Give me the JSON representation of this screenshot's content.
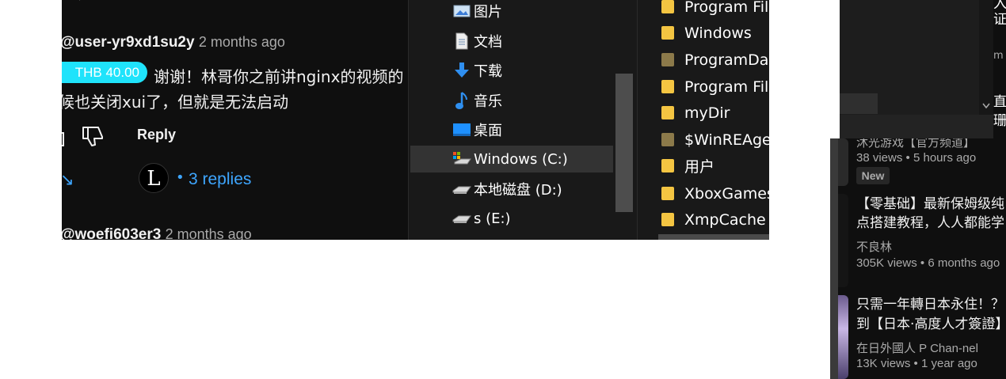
{
  "comments": {
    "first_user": "@user-yr9xd1su2y",
    "first_time": "2 months ago",
    "thanks_amount": "THB 40.00",
    "text_line1": "谢谢！林哥你之前讲nginx的视频的",
    "text_line2": "候也关闭xui了，但就是无法启动",
    "reply_label": "Reply",
    "avatar_letter": "L",
    "separator": "•",
    "replies_label": "3 replies",
    "second_user": "@woefi603er3",
    "second_time": "2 months ago",
    "accent_color": "#3ea6ff",
    "thanks_color": "#1fe3fb"
  },
  "explorer_nav": {
    "items": [
      {
        "label": "图片",
        "icon": "pictures-icon"
      },
      {
        "label": "文档",
        "icon": "documents-icon"
      },
      {
        "label": "下载",
        "icon": "downloads-icon"
      },
      {
        "label": "音乐",
        "icon": "music-icon"
      },
      {
        "label": "桌面",
        "icon": "desktop-icon"
      },
      {
        "label": "Windows (C:)",
        "icon": "drive-c-icon",
        "selected": true
      },
      {
        "label": "本地磁盘 (D:)",
        "icon": "drive-icon"
      },
      {
        "label": "s (E:)",
        "icon": "drive-icon"
      }
    ]
  },
  "explorer_files": {
    "items": [
      {
        "label": "Program Fil"
      },
      {
        "label": "Windows"
      },
      {
        "label": "ProgramDa"
      },
      {
        "label": "Program Fil"
      },
      {
        "label": "myDir"
      },
      {
        "label": "$WinREAge"
      },
      {
        "label": "用户"
      },
      {
        "label": "XboxGames"
      },
      {
        "label": "XmpCache"
      }
    ]
  },
  "right_edge": {
    "chars": [
      "入",
      "证",
      "m",
      "直",
      "珊"
    ]
  },
  "sidebar_videos": [
    {
      "channel_cut": "沐光游戏【官方频道】",
      "views": "38 views",
      "age": "5 hours ago",
      "badge": "New"
    },
    {
      "title_line1": "【零基础】最新保姆级纯",
      "title_line2": "点搭建教程，人人都能学",
      "channel": "不良林",
      "views": "305K views",
      "age": "6 months ago"
    },
    {
      "title_line1": "只需一年轉日本永住！？",
      "title_line2": "到【日本·高度人才簽證】",
      "channel": "在日外國人 P Chan-nel",
      "views": "13K views",
      "age": "1 year ago"
    }
  ],
  "meta_sep": "•"
}
